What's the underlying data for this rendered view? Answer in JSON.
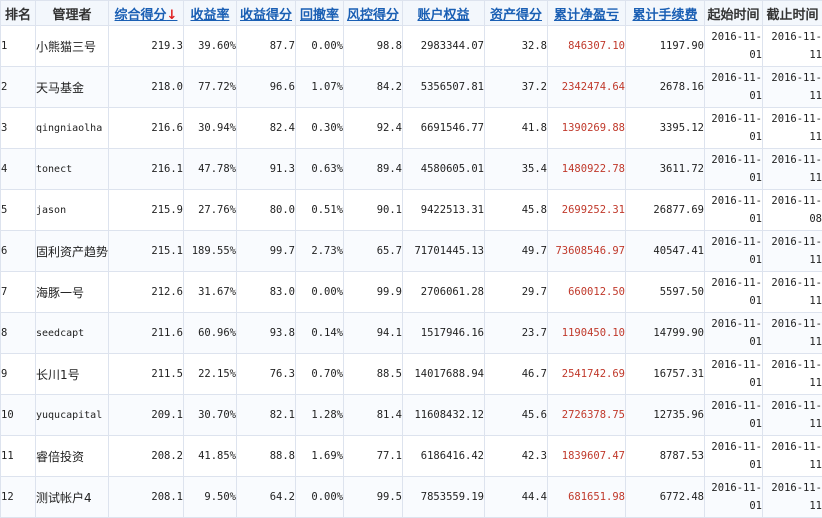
{
  "headers": {
    "rank": "排名",
    "manager": "管理者",
    "score": "综合得分",
    "sort_arrow": "↓",
    "return_rate": "收益率",
    "return_score": "收益得分",
    "drawdown": "回撤率",
    "risk_score": "风控得分",
    "equity": "账户权益",
    "asset_score": "资产得分",
    "net_pnl": "累计净盈亏",
    "fees": "累计手续费",
    "start": "起始时间",
    "end": "截止时间"
  },
  "colors": {
    "header_link": "#1a5fb4",
    "sort_arrow": "#e02020",
    "pnl": "#c0392b",
    "border": "#dde3ee"
  },
  "rows": [
    {
      "rank": "1",
      "manager": "小熊猫三号",
      "score": "219.3",
      "return_rate": "39.60%",
      "return_score": "87.7",
      "drawdown": "0.00%",
      "risk_score": "98.8",
      "equity": "2983344.07",
      "asset_score": "32.8",
      "net_pnl": "846307.10",
      "fees": "1197.90",
      "start_a": "2016-11-",
      "start_b": "01",
      "end_a": "2016-11-",
      "end_b": "11"
    },
    {
      "rank": "2",
      "manager": "天马基金",
      "score": "218.0",
      "return_rate": "77.72%",
      "return_score": "96.6",
      "drawdown": "1.07%",
      "risk_score": "84.2",
      "equity": "5356507.81",
      "asset_score": "37.2",
      "net_pnl": "2342474.64",
      "fees": "2678.16",
      "start_a": "2016-11-",
      "start_b": "01",
      "end_a": "2016-11-",
      "end_b": "11"
    },
    {
      "rank": "3",
      "manager": "qingniaolha",
      "score": "216.6",
      "return_rate": "30.94%",
      "return_score": "82.4",
      "drawdown": "0.30%",
      "risk_score": "92.4",
      "equity": "6691546.77",
      "asset_score": "41.8",
      "net_pnl": "1390269.88",
      "fees": "3395.12",
      "start_a": "2016-11-",
      "start_b": "01",
      "end_a": "2016-11-",
      "end_b": "11"
    },
    {
      "rank": "4",
      "manager": "tonect",
      "score": "216.1",
      "return_rate": "47.78%",
      "return_score": "91.3",
      "drawdown": "0.63%",
      "risk_score": "89.4",
      "equity": "4580605.01",
      "asset_score": "35.4",
      "net_pnl": "1480922.78",
      "fees": "3611.72",
      "start_a": "2016-11-",
      "start_b": "01",
      "end_a": "2016-11-",
      "end_b": "11"
    },
    {
      "rank": "5",
      "manager": "jason",
      "score": "215.9",
      "return_rate": "27.76%",
      "return_score": "80.0",
      "drawdown": "0.51%",
      "risk_score": "90.1",
      "equity": "9422513.31",
      "asset_score": "45.8",
      "net_pnl": "2699252.31",
      "fees": "26877.69",
      "start_a": "2016-11-",
      "start_b": "01",
      "end_a": "2016-11-",
      "end_b": "08"
    },
    {
      "rank": "6",
      "manager": "固利资产趋势",
      "score": "215.1",
      "return_rate": "189.55%",
      "return_score": "99.7",
      "drawdown": "2.73%",
      "risk_score": "65.7",
      "equity": "71701445.13",
      "asset_score": "49.7",
      "net_pnl": "73608546.97",
      "fees": "40547.41",
      "start_a": "2016-11-",
      "start_b": "01",
      "end_a": "2016-11-",
      "end_b": "11"
    },
    {
      "rank": "7",
      "manager": "海豚一号",
      "score": "212.6",
      "return_rate": "31.67%",
      "return_score": "83.0",
      "drawdown": "0.00%",
      "risk_score": "99.9",
      "equity": "2706061.28",
      "asset_score": "29.7",
      "net_pnl": "660012.50",
      "fees": "5597.50",
      "start_a": "2016-11-",
      "start_b": "01",
      "end_a": "2016-11-",
      "end_b": "11"
    },
    {
      "rank": "8",
      "manager": "seedcapt",
      "score": "211.6",
      "return_rate": "60.96%",
      "return_score": "93.8",
      "drawdown": "0.14%",
      "risk_score": "94.1",
      "equity": "1517946.16",
      "asset_score": "23.7",
      "net_pnl": "1190450.10",
      "fees": "14799.90",
      "start_a": "2016-11-",
      "start_b": "01",
      "end_a": "2016-11-",
      "end_b": "11"
    },
    {
      "rank": "9",
      "manager": "长川1号",
      "score": "211.5",
      "return_rate": "22.15%",
      "return_score": "76.3",
      "drawdown": "0.70%",
      "risk_score": "88.5",
      "equity": "14017688.94",
      "asset_score": "46.7",
      "net_pnl": "2541742.69",
      "fees": "16757.31",
      "start_a": "2016-11-",
      "start_b": "01",
      "end_a": "2016-11-",
      "end_b": "11"
    },
    {
      "rank": "10",
      "manager": "yuqucapital",
      "score": "209.1",
      "return_rate": "30.70%",
      "return_score": "82.1",
      "drawdown": "1.28%",
      "risk_score": "81.4",
      "equity": "11608432.12",
      "asset_score": "45.6",
      "net_pnl": "2726378.75",
      "fees": "12735.96",
      "start_a": "2016-11-",
      "start_b": "01",
      "end_a": "2016-11-",
      "end_b": "11"
    },
    {
      "rank": "11",
      "manager": "睿倍投资",
      "score": "208.2",
      "return_rate": "41.85%",
      "return_score": "88.8",
      "drawdown": "1.69%",
      "risk_score": "77.1",
      "equity": "6186416.42",
      "asset_score": "42.3",
      "net_pnl": "1839607.47",
      "fees": "8787.53",
      "start_a": "2016-11-",
      "start_b": "01",
      "end_a": "2016-11-",
      "end_b": "11"
    },
    {
      "rank": "12",
      "manager": "测试帐户4",
      "score": "208.1",
      "return_rate": "9.50%",
      "return_score": "64.2",
      "drawdown": "0.00%",
      "risk_score": "99.5",
      "equity": "7853559.19",
      "asset_score": "44.4",
      "net_pnl": "681651.98",
      "fees": "6772.48",
      "start_a": "2016-11-",
      "start_b": "01",
      "end_a": "2016-11-",
      "end_b": "11"
    }
  ]
}
